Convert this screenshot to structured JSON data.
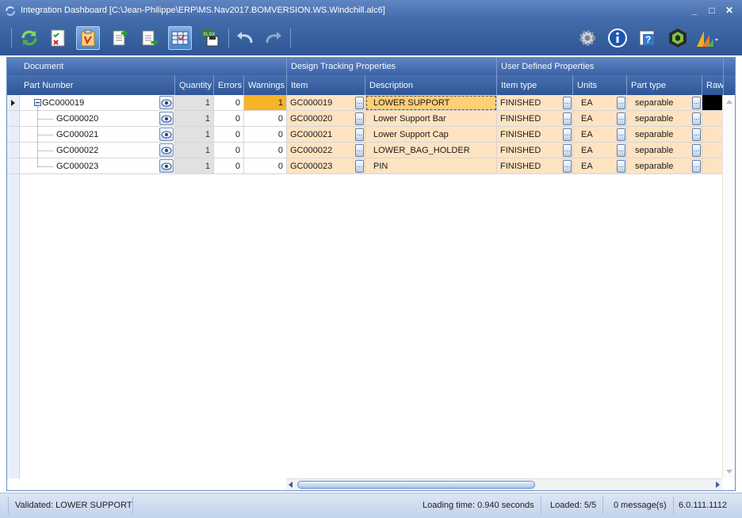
{
  "window": {
    "title": "Integration Dashboard [C:\\Jean-Philippe\\ERP\\MS.Nav2017.BOMVERSION.WS.Windchill.alc6]",
    "minimize_glyph": "_",
    "maximize_glyph": "□",
    "close_glyph": "✕"
  },
  "toolbar": {
    "left_icons": [
      "refresh-icon",
      "checklist-icon",
      "clipboard-icon",
      "new-document-icon",
      "add-document-icon",
      "spreadsheet-icon",
      "xlsx-save-icon",
      "undo-icon",
      "redo-icon"
    ],
    "right_icons": [
      "settings-gear-icon",
      "info-icon",
      "help-icon",
      "integration-logo-icon",
      "dynamics-logo-icon"
    ]
  },
  "grid": {
    "bands": {
      "document": "Document",
      "design_tracking": "Design Tracking Properties",
      "user_defined": "User Defined Properties"
    },
    "columns": {
      "part_number": "Part Number",
      "quantity": "Quantity",
      "errors": "Errors",
      "warnings": "Warnings",
      "item": "Item",
      "description": "Description",
      "item_type": "Item type",
      "units": "Units",
      "part_type": "Part type",
      "raw": "Raw"
    },
    "rows": [
      {
        "part_number": "GC000019",
        "quantity": "1",
        "errors": "0",
        "warnings": "1",
        "item": "GC000019",
        "description": "LOWER SUPPORT",
        "item_type": "FINISHED",
        "units": "EA",
        "part_type": "separable"
      },
      {
        "part_number": "GC000020",
        "quantity": "1",
        "errors": "0",
        "warnings": "0",
        "item": "GC000020",
        "description": "Lower Support Bar",
        "item_type": "FINISHED",
        "units": "EA",
        "part_type": "separable"
      },
      {
        "part_number": "GC000021",
        "quantity": "1",
        "errors": "0",
        "warnings": "0",
        "item": "GC000021",
        "description": "Lower Support Cap",
        "item_type": "FINISHED",
        "units": "EA",
        "part_type": "separable"
      },
      {
        "part_number": "GC000022",
        "quantity": "1",
        "errors": "0",
        "warnings": "0",
        "item": "GC000022",
        "description": "LOWER_BAG_HOLDER",
        "item_type": "FINISHED",
        "units": "EA",
        "part_type": "separable"
      },
      {
        "part_number": "GC000023",
        "quantity": "1",
        "errors": "0",
        "warnings": "0",
        "item": "GC000023",
        "description": "PIN",
        "item_type": "FINISHED",
        "units": "EA",
        "part_type": "separable"
      }
    ]
  },
  "status": {
    "validated": "Validated: LOWER SUPPORT",
    "loading_time": "Loading time: 0.940 seconds",
    "loaded": "Loaded: 5/5",
    "messages": "0 message(s)",
    "version": "6.0.111.1112"
  },
  "colors": {
    "warning": "#f6b42a",
    "design_cells": "#fde3c2",
    "header_blue": "#3b63a6"
  }
}
